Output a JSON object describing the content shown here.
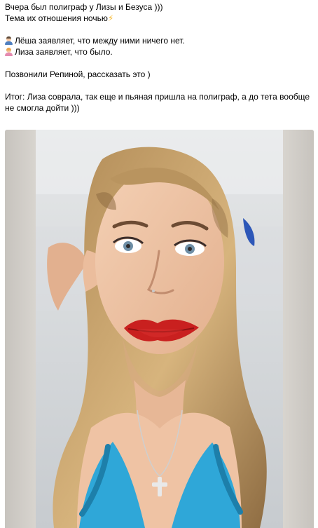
{
  "post": {
    "lines": [
      "Вчера был полиграф у Лизы и Безуса )))",
      "Тема их отношения ночью",
      "Лёша заявляет, что между ними ничего нет.",
      "Лиза заявляет, что было.",
      "Позвонили Репиной, рассказать это )",
      "Итог: Лиза соврала, так еще и пьяная пришла на полиграф, а до тета вообще не смогла дойти )))"
    ],
    "emoji": {
      "lightning": "⚡",
      "man": "man-emoji-icon",
      "woman": "woman-emoji-icon"
    }
  },
  "photo": {
    "icon": "portrait-photo",
    "colors": {
      "background": "#d9d6d1",
      "wall": "#dfe1e2",
      "hair": "#c9a46e",
      "skin": "#eec4a7",
      "lips": "#c9201f",
      "top": "#2fa7d8",
      "clip": "#2d57b8"
    }
  }
}
